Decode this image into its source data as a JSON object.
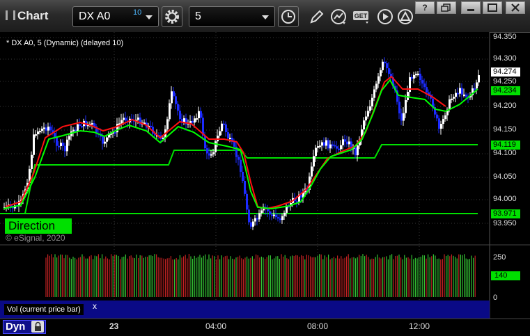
{
  "window": {
    "title": "Chart",
    "controls": {
      "help": "?",
      "restore": "",
      "minimize": "",
      "maximize": "",
      "close": ""
    }
  },
  "toolbar": {
    "symbol": "DX A0",
    "symbol_superscript": "10",
    "interval": "5",
    "icons": [
      "settings-gear-icon",
      "clock-icon",
      "pencil-icon",
      "study-chart-icon",
      "get-icon",
      "play-icon",
      "alert-triangle-icon"
    ],
    "get_label": "GET"
  },
  "chart": {
    "study_label": "* DX A0, 5 (Dynamic) (delayed 10)",
    "copyright": "© eSignal, 2020",
    "direction_label": "Direction",
    "price_axis": [
      "94.350",
      "94.300",
      "94.250",
      "94.200",
      "94.150",
      "94.100",
      "94.050",
      "94.000",
      "93.950"
    ],
    "price_tags": [
      {
        "value": "94.274",
        "kind": "last",
        "color": "#ffffff"
      },
      {
        "value": "94.234",
        "kind": "fast-ma",
        "color": "#00e000"
      },
      {
        "value": "94.119",
        "kind": "level",
        "color": "#00e000"
      },
      {
        "value": "93.971",
        "kind": "level",
        "color": "#00e000"
      }
    ],
    "time_axis": [
      "23",
      "04:00",
      "08:00",
      "12:00"
    ],
    "colors": {
      "up": "#ffffff",
      "down": "#1c2bff",
      "fast_ma": "#00ff00",
      "slow_ma": "#ff0000",
      "level": "#00e000"
    }
  },
  "volume": {
    "label": "Vol (current price bar)",
    "close_symbol": "x",
    "axis": [
      "250",
      "0"
    ],
    "current_value": "140"
  },
  "footer": {
    "mode": "Dyn"
  }
}
